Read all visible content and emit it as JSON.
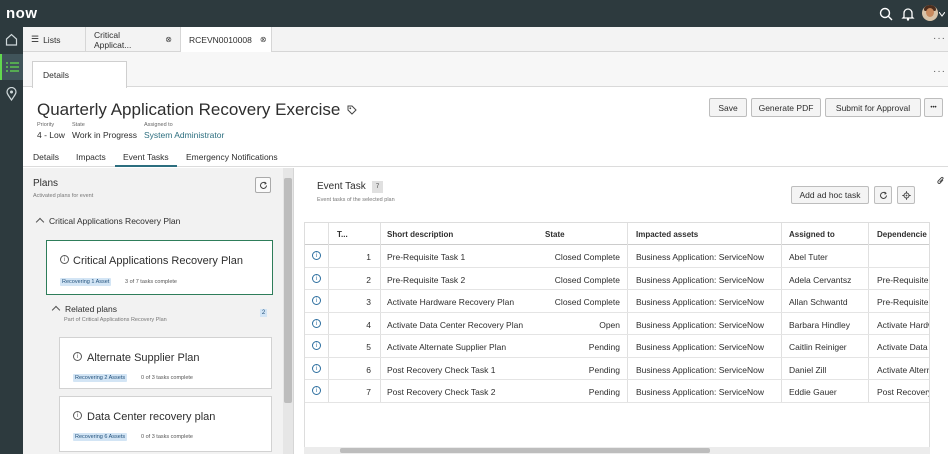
{
  "brand": {
    "logo": "now"
  },
  "tabs": [
    {
      "label": "Lists"
    },
    {
      "label": "Critical Applicat...",
      "close": "⊗"
    },
    {
      "label": "RCEVN0010008",
      "close": "⊗"
    }
  ],
  "subtab": {
    "label": "Details"
  },
  "record": {
    "title": "Quarterly Application Recovery Exercise",
    "priority_label": "Priority",
    "priority_value": "4 - Low",
    "state_label": "State",
    "state_value": "Work in Progress",
    "assigned_label": "Assigned to",
    "assigned_value": "System Administrator"
  },
  "actions": {
    "save": "Save",
    "generate_pdf": "Generate PDF",
    "submit": "Submit for Approval",
    "more": "•••"
  },
  "navtabs": [
    "Details",
    "Impacts",
    "Event Tasks",
    "Emergency Notifications"
  ],
  "plans": {
    "title": "Plans",
    "subtitle": "Activated plans for event",
    "group_label": "Critical Applications Recovery Plan",
    "selected_card": {
      "title": "Critical Applications Recovery Plan",
      "badge": "Recovering 1 Asset",
      "progress": "3 of 7 tasks complete"
    },
    "related_label": "Related plans",
    "related_sub": "Part of Critical Applications Recovery Plan",
    "related_count": "2",
    "related_cards": [
      {
        "title": "Alternate Supplier Plan",
        "badge": "Recovering 2 Assets",
        "progress": "0 of 3 tasks complete"
      },
      {
        "title": "Data Center recovery plan",
        "badge": "Recovering 6 Assets",
        "progress": "0 of 3 tasks complete"
      }
    ]
  },
  "event_task": {
    "title": "Event Task",
    "badge": "7",
    "subtitle": "Event tasks of the selected plan",
    "add_button": "Add ad hoc task"
  },
  "table": {
    "columns": [
      "T...",
      "Short description",
      "State",
      "Impacted assets",
      "Assigned to",
      "Dependencie"
    ],
    "rows": [
      {
        "num": "1",
        "desc": "Pre-Requisite Task 1",
        "state": "Closed Complete",
        "asset": "Business Application: ServiceNow",
        "assigned": "Abel Tuter",
        "dep": ""
      },
      {
        "num": "2",
        "desc": "Pre-Requisite Task 2",
        "state": "Closed Complete",
        "asset": "Business Application: ServiceNow",
        "assigned": "Adela Cervantsz",
        "dep": "Pre-Requisite"
      },
      {
        "num": "3",
        "desc": "Activate Hardware Recovery Plan",
        "state": "Closed Complete",
        "asset": "Business Application: ServiceNow",
        "assigned": "Allan Schwantd",
        "dep": "Pre-Requisite"
      },
      {
        "num": "4",
        "desc": "Activate Data Center Recovery Plan",
        "state": "Open",
        "asset": "Business Application: ServiceNow",
        "assigned": "Barbara Hindley",
        "dep": "Activate Hardw"
      },
      {
        "num": "5",
        "desc": "Activate Alternate Supplier Plan",
        "state": "Pending",
        "asset": "Business Application: ServiceNow",
        "assigned": "Caitlin Reiniger",
        "dep": "Activate Data"
      },
      {
        "num": "6",
        "desc": "Post Recovery Check Task 1",
        "state": "Pending",
        "asset": "Business Application: ServiceNow",
        "assigned": "Daniel Zill",
        "dep": "Activate Altern"
      },
      {
        "num": "7",
        "desc": "Post Recovery Check Task 2",
        "state": "Pending",
        "asset": "Business Application: ServiceNow",
        "assigned": "Eddie Gauer",
        "dep": "Post Recovery"
      }
    ]
  }
}
